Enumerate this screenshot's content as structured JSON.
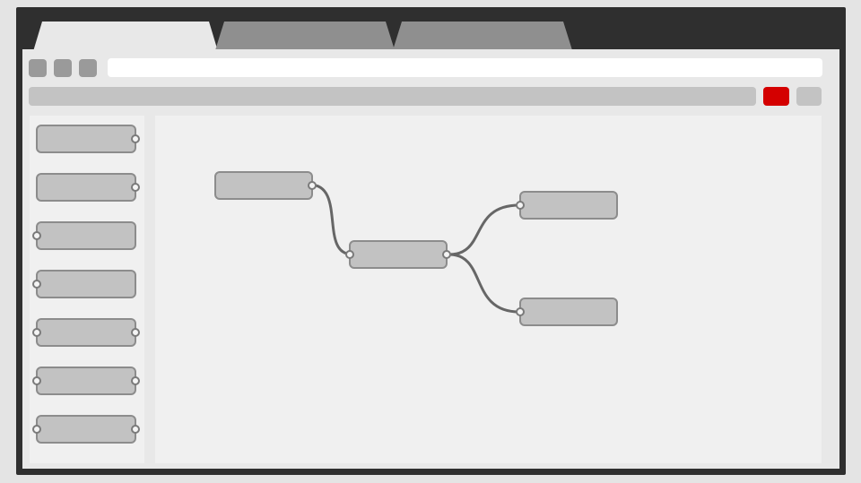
{
  "browser": {
    "tabs": [
      {
        "name": "tab-active",
        "state": "active",
        "fill": "#e8e8e8"
      },
      {
        "name": "tab-2",
        "state": "inactive",
        "fill": "#8f8f8f"
      },
      {
        "name": "tab-3",
        "state": "inactive",
        "fill": "#8f8f8f"
      }
    ],
    "address_bar": {
      "value": ""
    },
    "window_buttons": [
      "close",
      "minimize",
      "maximize"
    ]
  },
  "editor": {
    "palette": {
      "nodes": [
        {
          "ports": [
            "output"
          ]
        },
        {
          "ports": [
            "output"
          ]
        },
        {
          "ports": [
            "input"
          ]
        },
        {
          "ports": [
            "input"
          ]
        },
        {
          "ports": [
            "input",
            "output"
          ]
        },
        {
          "ports": [
            "input",
            "output"
          ]
        },
        {
          "ports": [
            "input",
            "output"
          ]
        }
      ]
    },
    "flow": {
      "nodes": [
        {
          "id": "n1",
          "ports": [
            "output"
          ]
        },
        {
          "id": "n2",
          "ports": [
            "input",
            "output"
          ]
        },
        {
          "id": "n3",
          "ports": [
            "input"
          ]
        },
        {
          "id": "n4",
          "ports": [
            "input"
          ]
        }
      ],
      "wires": [
        {
          "from": "n1",
          "to": "n2"
        },
        {
          "from": "n2",
          "to": "n3"
        },
        {
          "from": "n2",
          "to": "n4"
        }
      ]
    }
  },
  "colors": {
    "window_frame": "#2f2f2f",
    "background": "#e4e4e4",
    "panel": "#f0f0f0",
    "node_fill": "#c2c2c2",
    "node_border": "#8c8c8c",
    "deploy_accent": "#d40000",
    "wire": "#666666"
  }
}
